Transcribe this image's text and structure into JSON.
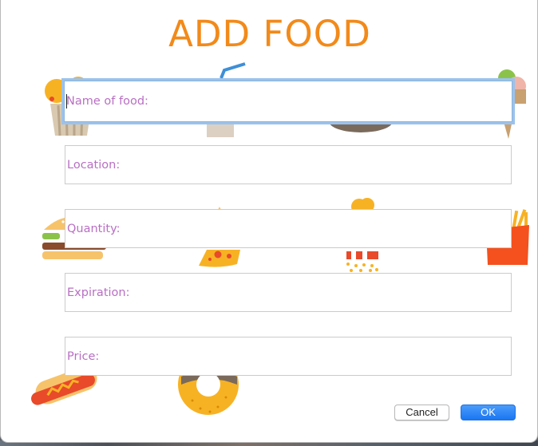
{
  "dialog": {
    "title": "ADD FOOD",
    "fields": {
      "name": {
        "label": "Name of food:",
        "value": ""
      },
      "location": {
        "label": "Location:",
        "value": ""
      },
      "quantity": {
        "label": "Quantity:",
        "value": ""
      },
      "expiration": {
        "label": "Expiration:",
        "value": ""
      },
      "price": {
        "label": "Price:",
        "value": ""
      }
    },
    "buttons": {
      "cancel": "Cancel",
      "ok": "OK"
    },
    "decorations": [
      "cupcake-icon",
      "drink-icon",
      "bowl-icon",
      "ice-cream-icon",
      "burger-icon",
      "pizza-icon",
      "popcorn-icon",
      "fries-icon",
      "hotdog-icon",
      "donut-icon"
    ]
  },
  "colors": {
    "title": "#f28a1a",
    "label": "#b96fc4",
    "accent": "#1a77f2",
    "focus_ring": "#9cc2ea"
  }
}
